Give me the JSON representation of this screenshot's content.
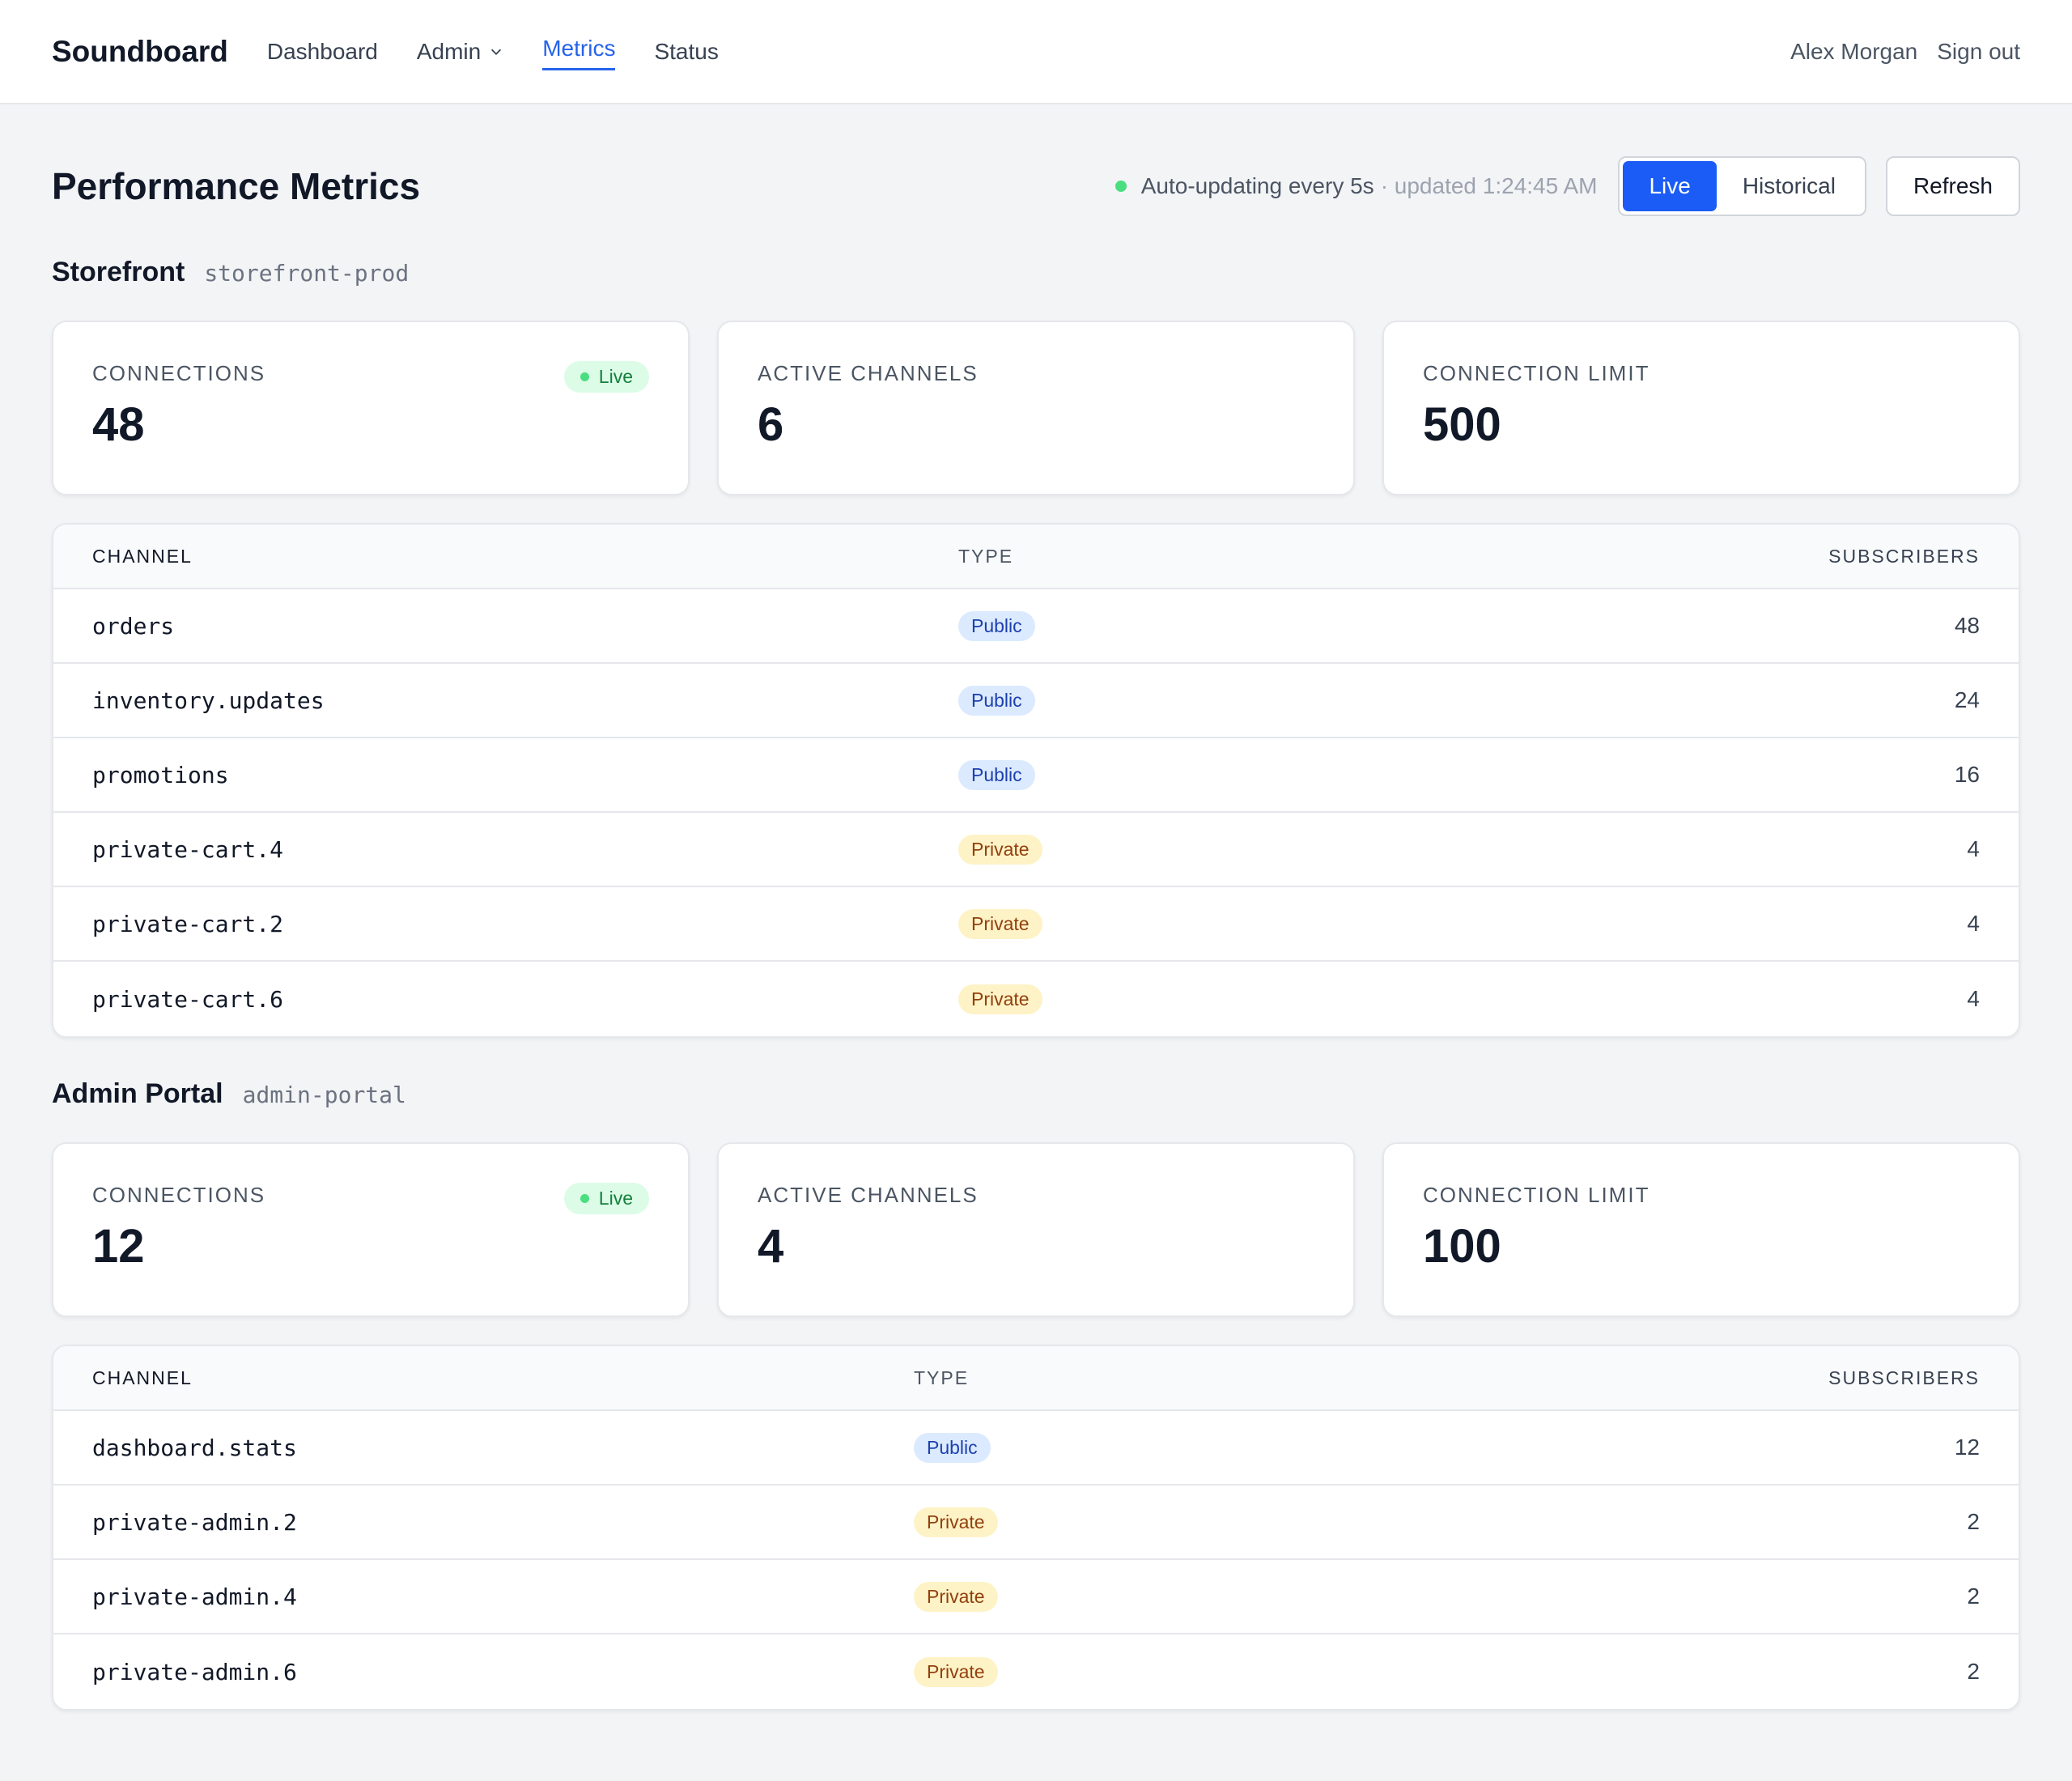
{
  "nav": {
    "brand": "Soundboard",
    "links": [
      {
        "label": "Dashboard"
      },
      {
        "label": "Admin"
      },
      {
        "label": "Metrics"
      },
      {
        "label": "Status"
      }
    ],
    "user": "Alex Morgan",
    "signout": "Sign out"
  },
  "header": {
    "title": "Performance Metrics",
    "status_text": "Auto-updating every 5s",
    "updated_text": "· updated 1:24:45 AM",
    "mode_live": "Live",
    "mode_historical": "Historical",
    "refresh": "Refresh"
  },
  "colors": {
    "accent": "#1a5cf5",
    "live_green": "#4ade80",
    "public_badge": "#dbeafe",
    "private_badge": "#fef3c7"
  },
  "apps": [
    {
      "name": "Storefront",
      "slug": "storefront-prod",
      "cards": [
        {
          "label": "CONNECTIONS",
          "value": "48",
          "badge": "Live"
        },
        {
          "label": "ACTIVE CHANNELS",
          "value": "6"
        },
        {
          "label": "CONNECTION LIMIT",
          "value": "500"
        }
      ],
      "table": {
        "headers": [
          "CHANNEL",
          "TYPE",
          "SUBSCRIBERS"
        ],
        "rows": [
          {
            "channel": "orders",
            "type": "Public",
            "subscribers": "48"
          },
          {
            "channel": "inventory.updates",
            "type": "Public",
            "subscribers": "24"
          },
          {
            "channel": "promotions",
            "type": "Public",
            "subscribers": "16"
          },
          {
            "channel": "private-cart.4",
            "type": "Private",
            "subscribers": "4"
          },
          {
            "channel": "private-cart.2",
            "type": "Private",
            "subscribers": "4"
          },
          {
            "channel": "private-cart.6",
            "type": "Private",
            "subscribers": "4"
          }
        ]
      }
    },
    {
      "name": "Admin Portal",
      "slug": "admin-portal",
      "cards": [
        {
          "label": "CONNECTIONS",
          "value": "12",
          "badge": "Live"
        },
        {
          "label": "ACTIVE CHANNELS",
          "value": "4"
        },
        {
          "label": "CONNECTION LIMIT",
          "value": "100"
        }
      ],
      "table": {
        "headers": [
          "CHANNEL",
          "TYPE",
          "SUBSCRIBERS"
        ],
        "rows": [
          {
            "channel": "dashboard.stats",
            "type": "Public",
            "subscribers": "12"
          },
          {
            "channel": "private-admin.2",
            "type": "Private",
            "subscribers": "2"
          },
          {
            "channel": "private-admin.4",
            "type": "Private",
            "subscribers": "2"
          },
          {
            "channel": "private-admin.6",
            "type": "Private",
            "subscribers": "2"
          }
        ]
      }
    }
  ]
}
